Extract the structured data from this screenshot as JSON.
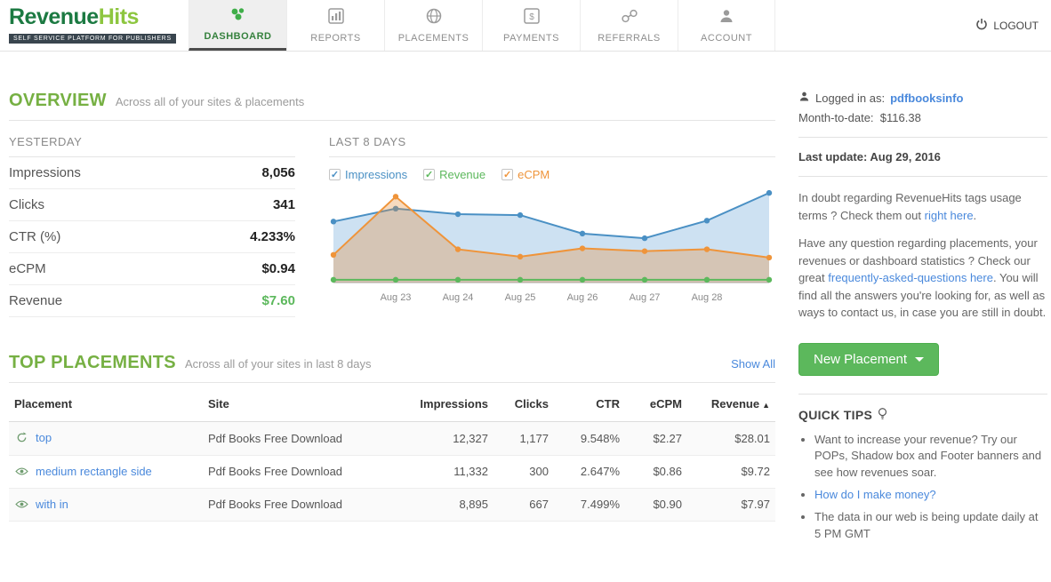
{
  "brand": {
    "name_part1": "Revenue",
    "name_part2": "Hits",
    "tagline": "SELF SERVICE PLATFORM FOR PUBLISHERS"
  },
  "nav": {
    "items": [
      {
        "label": "DASHBOARD",
        "active": true
      },
      {
        "label": "REPORTS",
        "active": false
      },
      {
        "label": "PLACEMENTS",
        "active": false
      },
      {
        "label": "PAYMENTS",
        "active": false
      },
      {
        "label": "REFERRALS",
        "active": false
      },
      {
        "label": "ACCOUNT",
        "active": false
      }
    ],
    "logout_label": "LOGOUT"
  },
  "overview": {
    "title": "OVERVIEW",
    "subtitle": "Across all of your sites & placements",
    "yesterday": {
      "title": "YESTERDAY",
      "stats": [
        {
          "label": "Impressions",
          "value": "8,056",
          "highlight": false
        },
        {
          "label": "Clicks",
          "value": "341",
          "highlight": false
        },
        {
          "label": "CTR (%)",
          "value": "4.233%",
          "highlight": false
        },
        {
          "label": "eCPM",
          "value": "$0.94",
          "highlight": false
        },
        {
          "label": "Revenue",
          "value": "$7.60",
          "highlight": true
        }
      ]
    },
    "chart_section_title": "LAST 8 DAYS"
  },
  "chart_data": {
    "type": "area",
    "title": "LAST 8 DAYS",
    "x": [
      "",
      "Aug 23",
      "Aug 24",
      "Aug 25",
      "Aug 26",
      "Aug 27",
      "Aug 28",
      ""
    ],
    "legend": [
      {
        "label": "Impressions",
        "color": "#4a90c4"
      },
      {
        "label": "Revenue",
        "color": "#5cb85c"
      },
      {
        "label": "eCPM",
        "color": "#ef943a"
      }
    ],
    "series": [
      {
        "name": "Impressions",
        "color": "#4a90c4",
        "fill": "rgba(91,155,213,0.30)",
        "area": true,
        "values_pct": [
          66,
          80,
          74,
          73,
          53,
          48,
          67,
          97
        ]
      },
      {
        "name": "eCPM",
        "color": "#ef943a",
        "fill": "rgba(230,140,52,0.32)",
        "area": true,
        "values_pct": [
          30,
          93,
          36,
          28,
          37,
          34,
          36,
          27
        ]
      },
      {
        "name": "Revenue",
        "color": "#5cb85c",
        "fill": "none",
        "area": false,
        "values_pct": [
          3,
          3,
          3,
          3,
          3,
          3,
          3,
          3
        ]
      }
    ],
    "ylim_pct": [
      0,
      100
    ],
    "grid": false,
    "legend_position": "top"
  },
  "top_placements": {
    "title": "TOP PLACEMENTS",
    "subtitle": "Across all of your sites in last 8 days",
    "show_all_label": "Show All",
    "columns": [
      "Placement",
      "Site",
      "Impressions",
      "Clicks",
      "CTR",
      "eCPM",
      "Revenue"
    ],
    "sort_arrow": "▲",
    "rows": [
      {
        "icon": "pop",
        "placement": "top",
        "site": "Pdf Books Free Download",
        "impressions": "12,327",
        "clicks": "1,177",
        "ctr": "9.548%",
        "ecpm": "$2.27",
        "revenue": "$28.01"
      },
      {
        "icon": "eye",
        "placement": "medium rectangle side",
        "site": "Pdf Books Free Download",
        "impressions": "11,332",
        "clicks": "300",
        "ctr": "2.647%",
        "ecpm": "$0.86",
        "revenue": "$9.72"
      },
      {
        "icon": "eye",
        "placement": "with in",
        "site": "Pdf Books Free Download",
        "impressions": "8,895",
        "clicks": "667",
        "ctr": "7.499%",
        "ecpm": "$0.90",
        "revenue": "$7.97"
      }
    ]
  },
  "sidebar": {
    "logged_in_label": "Logged in as:",
    "username": "pdfbooksinfo",
    "mtd_label": "Month-to-date:",
    "mtd_value": "$116.38",
    "last_update": "Last update: Aug 29, 2016",
    "note1_segments": [
      {
        "t": "In doubt regarding RevenueHits tags usage terms ? Check them out ",
        "link": false
      },
      {
        "t": "right here",
        "link": true
      },
      {
        "t": ".",
        "link": false
      }
    ],
    "note2_segments": [
      {
        "t": "Have any question regarding placements, your revenues or dashboard statistics ? Check our great ",
        "link": false
      },
      {
        "t": "frequently-asked-questions here",
        "link": true
      },
      {
        "t": ". You will find all the answers you're looking for, as well as ways to contact us, in case you are still in doubt.",
        "link": false
      }
    ],
    "new_placement_label": "New Placement",
    "quick_tips": {
      "title": "QUICK TIPS",
      "tips": [
        {
          "t": "Want to increase your revenue? Try our POPs, Shadow box and Footer banners and see how revenues soar.",
          "link": false
        },
        {
          "t": "How do I make money?",
          "link": true
        },
        {
          "t": "The data in our web is being update daily at 5 PM GMT",
          "link": false
        }
      ]
    }
  }
}
